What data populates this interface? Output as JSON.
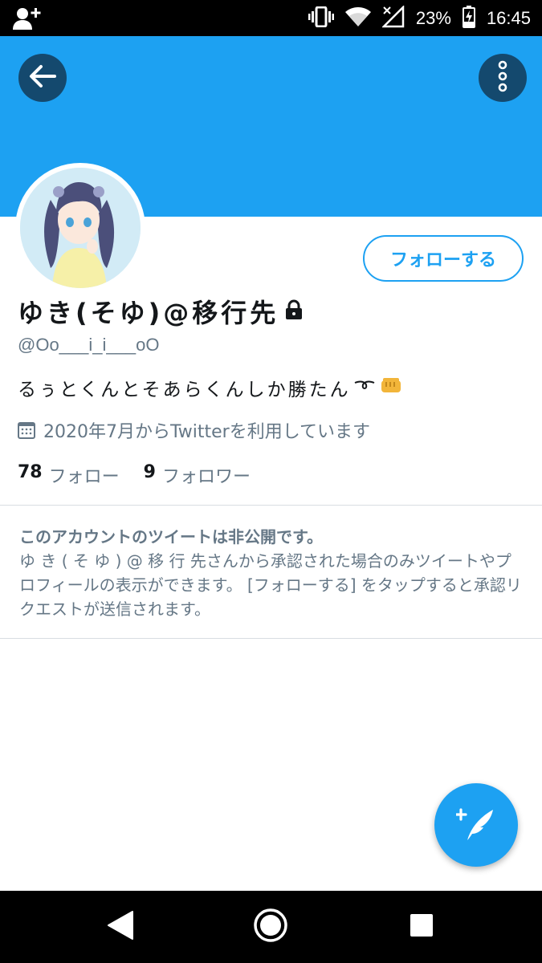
{
  "status_bar": {
    "battery_percent": "23%",
    "time": "16:45",
    "icons": [
      "add-person-icon",
      "vibrate-icon",
      "wifi-icon",
      "no-signal-icon",
      "battery-charging-icon"
    ]
  },
  "header": {
    "back_icon": "arrow-left-icon",
    "more_icon": "more-vertical-icon",
    "banner_color": "#1da1f2"
  },
  "profile": {
    "display_name": "ゆき(そゆ)@移行先",
    "handle": "@Oo___i_i___oO",
    "bio": "るぅとくんとそあらくんしか勝たん",
    "bio_emojis": [
      "curly-loop-icon",
      "fist-icon"
    ],
    "joined": "2020年7月からTwitterを利用しています",
    "following_count": "78",
    "following_label": "フォロー",
    "followers_count": "9",
    "followers_label": "フォロワー",
    "follow_button": "フォローする"
  },
  "private_notice": {
    "title": "このアカウントのツイートは非公開です。",
    "body": "ゆ き ( そ ゆ ) @ 移 行 先さんから承認された場合のみツイートやプロフィールの表示ができます。 [フォローする] をタップすると承認リクエストが送信されます。"
  },
  "fab": {
    "icon": "compose-tweet-icon"
  },
  "nav_bar": {
    "icons": [
      "back-triangle-icon",
      "home-circle-icon",
      "recents-square-icon"
    ]
  },
  "colors": {
    "accent": "#1da1f2",
    "dark_button": "#14496e",
    "text_primary": "#14171a",
    "text_secondary": "#657786"
  }
}
